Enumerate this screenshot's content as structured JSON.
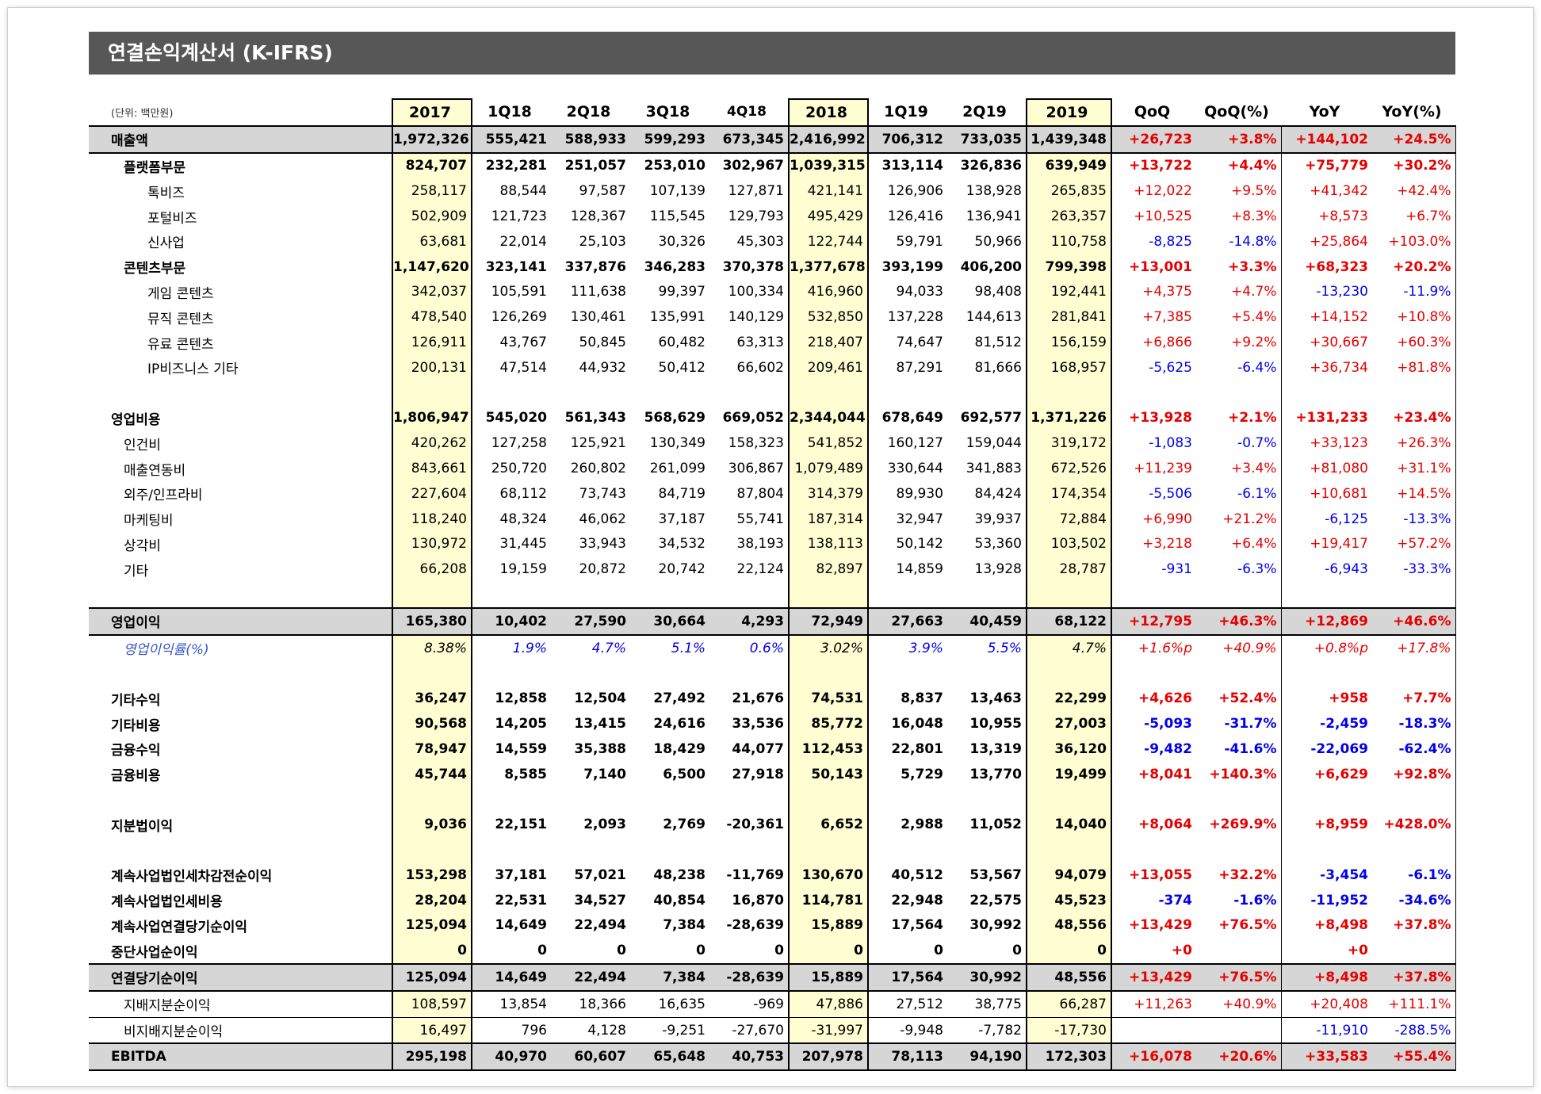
{
  "title": "연결손익계산서 (K-IFRS)",
  "unit_label": "(단위: 백만원)",
  "columns": [
    "2017",
    "1Q18",
    "2Q18",
    "3Q18",
    "4Q18",
    "2018",
    "1Q19",
    "2Q19",
    "2019",
    "QoQ",
    "QoQ(%)",
    "YoY",
    "YoY(%)"
  ],
  "rows": [
    {
      "label": "매출액",
      "style": "gray-bold",
      "values": [
        "1,972,326",
        "555,421",
        "588,933",
        "599,293",
        "673,345",
        "2,416,992",
        "706,312",
        "733,035",
        "1,439,348",
        "+26,723",
        "+3.8%",
        "+144,102",
        "+24.5%"
      ],
      "colors": [
        "red",
        "red",
        "red",
        "red"
      ]
    },
    {
      "label": "플랫폼부문",
      "style": "l1",
      "values": [
        "824,707",
        "232,281",
        "251,057",
        "253,010",
        "302,967",
        "1,039,315",
        "313,114",
        "326,836",
        "639,949",
        "+13,722",
        "+4.4%",
        "+75,779",
        "+30.2%"
      ],
      "colors": [
        "red",
        "red",
        "red",
        "red"
      ]
    },
    {
      "label": "톡비즈",
      "style": "l2",
      "values": [
        "258,117",
        "88,544",
        "97,587",
        "107,139",
        "127,871",
        "421,141",
        "126,906",
        "138,928",
        "265,835",
        "+12,022",
        "+9.5%",
        "+41,342",
        "+42.4%"
      ],
      "colors": [
        "red",
        "red",
        "red",
        "red"
      ]
    },
    {
      "label": "포털비즈",
      "style": "l2",
      "values": [
        "502,909",
        "121,723",
        "128,367",
        "115,545",
        "129,793",
        "495,429",
        "126,416",
        "136,941",
        "263,357",
        "+10,525",
        "+8.3%",
        "+8,573",
        "+6.7%"
      ],
      "colors": [
        "red",
        "red",
        "red",
        "red"
      ]
    },
    {
      "label": "신사업",
      "style": "l2",
      "values": [
        "63,681",
        "22,014",
        "25,103",
        "30,326",
        "45,303",
        "122,744",
        "59,791",
        "50,966",
        "110,758",
        "-8,825",
        "-14.8%",
        "+25,864",
        "+103.0%"
      ],
      "colors": [
        "blue",
        "blue",
        "red",
        "red"
      ]
    },
    {
      "label": "콘텐츠부문",
      "style": "l1",
      "values": [
        "1,147,620",
        "323,141",
        "337,876",
        "346,283",
        "370,378",
        "1,377,678",
        "393,199",
        "406,200",
        "799,398",
        "+13,001",
        "+3.3%",
        "+68,323",
        "+20.2%"
      ],
      "colors": [
        "red",
        "red",
        "red",
        "red"
      ]
    },
    {
      "label": "게임 콘텐츠",
      "style": "l2",
      "values": [
        "342,037",
        "105,591",
        "111,638",
        "99,397",
        "100,334",
        "416,960",
        "94,033",
        "98,408",
        "192,441",
        "+4,375",
        "+4.7%",
        "-13,230",
        "-11.9%"
      ],
      "colors": [
        "red",
        "red",
        "blue",
        "blue"
      ]
    },
    {
      "label": "뮤직 콘텐츠",
      "style": "l2",
      "values": [
        "478,540",
        "126,269",
        "130,461",
        "135,991",
        "140,129",
        "532,850",
        "137,228",
        "144,613",
        "281,841",
        "+7,385",
        "+5.4%",
        "+14,152",
        "+10.8%"
      ],
      "colors": [
        "red",
        "red",
        "red",
        "red"
      ]
    },
    {
      "label": "유료 콘텐츠",
      "style": "l2",
      "values": [
        "126,911",
        "43,767",
        "50,845",
        "60,482",
        "63,313",
        "218,407",
        "74,647",
        "81,512",
        "156,159",
        "+6,866",
        "+9.2%",
        "+30,667",
        "+60.3%"
      ],
      "colors": [
        "red",
        "red",
        "red",
        "red"
      ]
    },
    {
      "label": "IP비즈니스 기타",
      "style": "l2",
      "values": [
        "200,131",
        "47,514",
        "44,932",
        "50,412",
        "66,602",
        "209,461",
        "87,291",
        "81,666",
        "168,957",
        "-5,625",
        "-6.4%",
        "+36,734",
        "+81.8%"
      ],
      "colors": [
        "blue",
        "blue",
        "red",
        "red"
      ]
    },
    {
      "label": "",
      "style": "empty",
      "values": [
        "",
        "",
        "",
        "",
        "",
        "",
        "",
        "",
        "",
        "",
        "",
        "",
        ""
      ],
      "colors": [
        "",
        "",
        "",
        ""
      ]
    },
    {
      "label": "영업비용",
      "style": "l0",
      "values": [
        "1,806,947",
        "545,020",
        "561,343",
        "568,629",
        "669,052",
        "2,344,044",
        "678,649",
        "692,577",
        "1,371,226",
        "+13,928",
        "+2.1%",
        "+131,233",
        "+23.4%"
      ],
      "colors": [
        "red",
        "red",
        "red",
        "red"
      ]
    },
    {
      "label": "인건비",
      "style": "l3",
      "values": [
        "420,262",
        "127,258",
        "125,921",
        "130,349",
        "158,323",
        "541,852",
        "160,127",
        "159,044",
        "319,172",
        "-1,083",
        "-0.7%",
        "+33,123",
        "+26.3%"
      ],
      "colors": [
        "blue",
        "blue",
        "red",
        "red"
      ]
    },
    {
      "label": "매출연동비",
      "style": "l3",
      "values": [
        "843,661",
        "250,720",
        "260,802",
        "261,099",
        "306,867",
        "1,079,489",
        "330,644",
        "341,883",
        "672,526",
        "+11,239",
        "+3.4%",
        "+81,080",
        "+31.1%"
      ],
      "colors": [
        "red",
        "red",
        "red",
        "red"
      ]
    },
    {
      "label": "외주/인프라비",
      "style": "l3",
      "values": [
        "227,604",
        "68,112",
        "73,743",
        "84,719",
        "87,804",
        "314,379",
        "89,930",
        "84,424",
        "174,354",
        "-5,506",
        "-6.1%",
        "+10,681",
        "+14.5%"
      ],
      "colors": [
        "blue",
        "blue",
        "red",
        "red"
      ]
    },
    {
      "label": "마케팅비",
      "style": "l3",
      "values": [
        "118,240",
        "48,324",
        "46,062",
        "37,187",
        "55,741",
        "187,314",
        "32,947",
        "39,937",
        "72,884",
        "+6,990",
        "+21.2%",
        "-6,125",
        "-13.3%"
      ],
      "colors": [
        "red",
        "red",
        "blue",
        "blue"
      ]
    },
    {
      "label": "상각비",
      "style": "l3",
      "values": [
        "130,972",
        "31,445",
        "33,943",
        "34,532",
        "38,193",
        "138,113",
        "50,142",
        "53,360",
        "103,502",
        "+3,218",
        "+6.4%",
        "+19,417",
        "+57.2%"
      ],
      "colors": [
        "red",
        "red",
        "red",
        "red"
      ]
    },
    {
      "label": "기타",
      "style": "l3",
      "values": [
        "66,208",
        "19,159",
        "20,872",
        "20,742",
        "22,124",
        "82,897",
        "14,859",
        "13,928",
        "28,787",
        "-931",
        "-6.3%",
        "-6,943",
        "-33.3%"
      ],
      "colors": [
        "blue",
        "blue",
        "blue",
        "blue"
      ]
    },
    {
      "label": "",
      "style": "empty",
      "values": [
        "",
        "",
        "",
        "",
        "",
        "",
        "",
        "",
        "",
        "",
        "",
        "",
        ""
      ],
      "colors": [
        "",
        "",
        "",
        ""
      ]
    },
    {
      "label": "영업이익",
      "style": "gray-bold-box",
      "values": [
        "165,380",
        "10,402",
        "27,590",
        "30,664",
        "4,293",
        "72,949",
        "27,663",
        "40,459",
        "68,122",
        "+12,795",
        "+46.3%",
        "+12,869",
        "+46.6%"
      ],
      "colors": [
        "red",
        "red",
        "red",
        "red"
      ]
    },
    {
      "label": "영업이익률(%)",
      "style": "ital",
      "values": [
        "8.38%",
        "1.9%",
        "4.7%",
        "5.1%",
        "0.6%",
        "3.02%",
        "3.9%",
        "5.5%",
        "4.7%",
        "+1.6%p",
        "+40.9%",
        "+0.8%p",
        "+17.8%"
      ],
      "colors": [
        "red",
        "red",
        "red",
        "red"
      ]
    },
    {
      "label": "",
      "style": "empty",
      "values": [
        "",
        "",
        "",
        "",
        "",
        "",
        "",
        "",
        "",
        "",
        "",
        "",
        ""
      ],
      "colors": [
        "",
        "",
        "",
        ""
      ]
    },
    {
      "label": "기타수익",
      "style": "l0",
      "values": [
        "36,247",
        "12,858",
        "12,504",
        "27,492",
        "21,676",
        "74,531",
        "8,837",
        "13,463",
        "22,299",
        "+4,626",
        "+52.4%",
        "+958",
        "+7.7%"
      ],
      "colors": [
        "red",
        "red",
        "red",
        "red"
      ]
    },
    {
      "label": "기타비용",
      "style": "l0",
      "values": [
        "90,568",
        "14,205",
        "13,415",
        "24,616",
        "33,536",
        "85,772",
        "16,048",
        "10,955",
        "27,003",
        "-5,093",
        "-31.7%",
        "-2,459",
        "-18.3%"
      ],
      "colors": [
        "blue",
        "blue",
        "blue",
        "blue"
      ]
    },
    {
      "label": "금융수익",
      "style": "l0",
      "values": [
        "78,947",
        "14,559",
        "35,388",
        "18,429",
        "44,077",
        "112,453",
        "22,801",
        "13,319",
        "36,120",
        "-9,482",
        "-41.6%",
        "-22,069",
        "-62.4%"
      ],
      "colors": [
        "blue",
        "blue",
        "blue",
        "blue"
      ]
    },
    {
      "label": "금융비용",
      "style": "l0",
      "values": [
        "45,744",
        "8,585",
        "7,140",
        "6,500",
        "27,918",
        "50,143",
        "5,729",
        "13,770",
        "19,499",
        "+8,041",
        "+140.3%",
        "+6,629",
        "+92.8%"
      ],
      "colors": [
        "red",
        "red",
        "red",
        "red"
      ]
    },
    {
      "label": "",
      "style": "empty",
      "values": [
        "",
        "",
        "",
        "",
        "",
        "",
        "",
        "",
        "",
        "",
        "",
        "",
        ""
      ],
      "colors": [
        "",
        "",
        "",
        ""
      ]
    },
    {
      "label": "지분법이익",
      "style": "l0",
      "values": [
        "9,036",
        "22,151",
        "2,093",
        "2,769",
        "-20,361",
        "6,652",
        "2,988",
        "11,052",
        "14,040",
        "+8,064",
        "+269.9%",
        "+8,959",
        "+428.0%"
      ],
      "colors": [
        "red",
        "red",
        "red",
        "red"
      ]
    },
    {
      "label": "",
      "style": "empty",
      "values": [
        "",
        "",
        "",
        "",
        "",
        "",
        "",
        "",
        "",
        "",
        "",
        "",
        ""
      ],
      "colors": [
        "",
        "",
        "",
        ""
      ]
    },
    {
      "label": "계속사업법인세차감전순이익",
      "style": "l0",
      "values": [
        "153,298",
        "37,181",
        "57,021",
        "48,238",
        "-11,769",
        "130,670",
        "40,512",
        "53,567",
        "94,079",
        "+13,055",
        "+32.2%",
        "-3,454",
        "-6.1%"
      ],
      "colors": [
        "red",
        "red",
        "blue",
        "blue"
      ]
    },
    {
      "label": "계속사업법인세비용",
      "style": "l0",
      "values": [
        "28,204",
        "22,531",
        "34,527",
        "40,854",
        "16,870",
        "114,781",
        "22,948",
        "22,575",
        "45,523",
        "-374",
        "-1.6%",
        "-11,952",
        "-34.6%"
      ],
      "colors": [
        "blue",
        "blue",
        "blue",
        "blue"
      ]
    },
    {
      "label": "계속사업연결당기순이익",
      "style": "l0",
      "values": [
        "125,094",
        "14,649",
        "22,494",
        "7,384",
        "-28,639",
        "15,889",
        "17,564",
        "30,992",
        "48,556",
        "+13,429",
        "+76.5%",
        "+8,498",
        "+37.8%"
      ],
      "colors": [
        "red",
        "red",
        "red",
        "red"
      ]
    },
    {
      "label": "중단사업순이익",
      "style": "l0",
      "values": [
        "0",
        "0",
        "0",
        "0",
        "0",
        "0",
        "0",
        "0",
        "0",
        "+0",
        "",
        "+0",
        ""
      ],
      "colors": [
        "red",
        "",
        "red",
        ""
      ]
    },
    {
      "label": "연결당기순이익",
      "style": "gray-bold-box",
      "values": [
        "125,094",
        "14,649",
        "22,494",
        "7,384",
        "-28,639",
        "15,889",
        "17,564",
        "30,992",
        "48,556",
        "+13,429",
        "+76.5%",
        "+8,498",
        "+37.8%"
      ],
      "colors": [
        "red",
        "red",
        "red",
        "red"
      ]
    },
    {
      "label": "지배지분순이익",
      "style": "l3-thin",
      "values": [
        "108,597",
        "13,854",
        "18,366",
        "16,635",
        "-969",
        "47,886",
        "27,512",
        "38,775",
        "66,287",
        "+11,263",
        "+40.9%",
        "+20,408",
        "+111.1%"
      ],
      "colors": [
        "red",
        "red",
        "red",
        "red"
      ]
    },
    {
      "label": "비지배지분순이익",
      "style": "l3",
      "values": [
        "16,497",
        "796",
        "4,128",
        "-9,251",
        "-27,670",
        "-31,997",
        "-9,948",
        "-7,782",
        "-17,730",
        "",
        "",
        "-11,910",
        "-288.5%"
      ],
      "colors": [
        "",
        "",
        "blue",
        "blue"
      ]
    },
    {
      "label": "EBITDA",
      "style": "gray-bold-box",
      "values": [
        "295,198",
        "40,970",
        "60,607",
        "65,648",
        "40,753",
        "207,978",
        "78,113",
        "94,190",
        "172,303",
        "+16,078",
        "+20.6%",
        "+33,583",
        "+55.4%"
      ],
      "colors": [
        "red",
        "red",
        "red",
        "red"
      ]
    }
  ]
}
